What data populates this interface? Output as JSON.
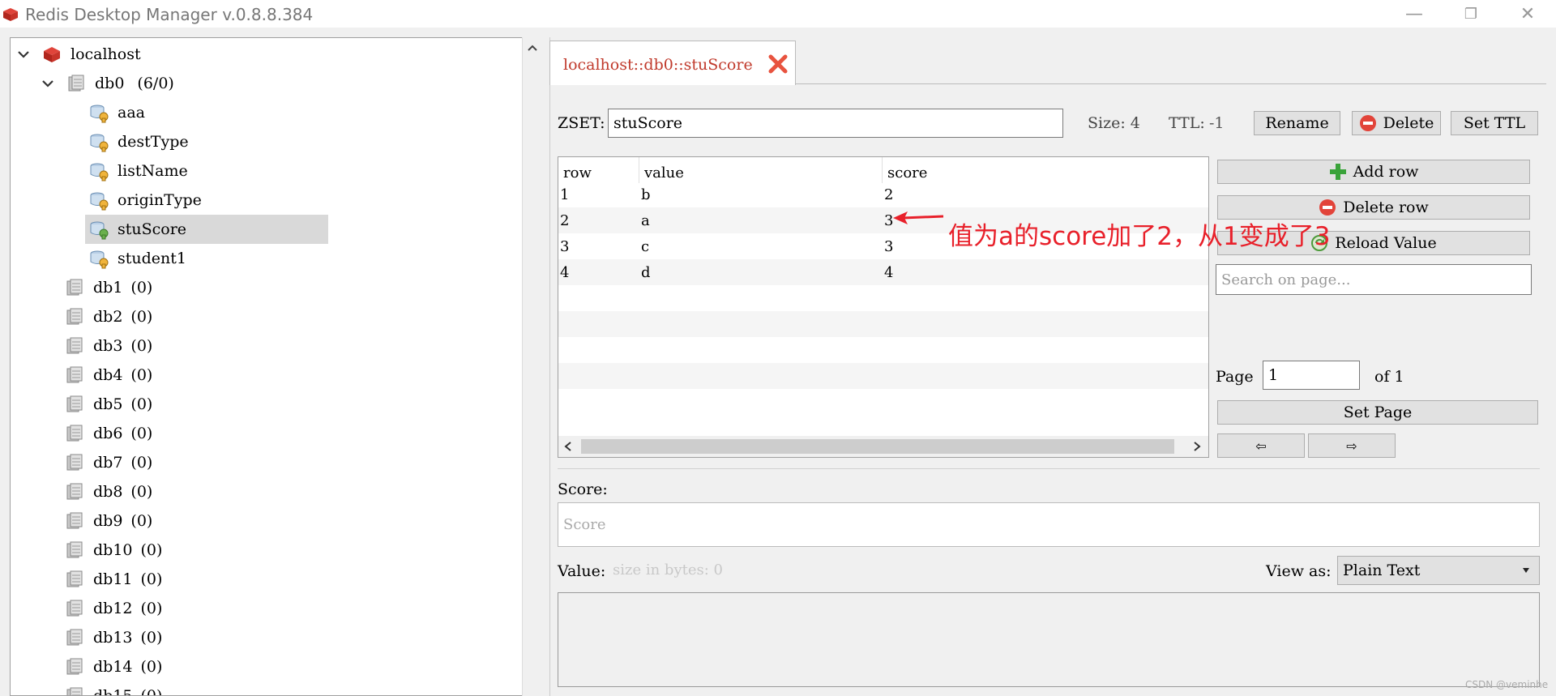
{
  "window": {
    "title": "Redis Desktop Manager v.0.8.8.384",
    "minimize": "—",
    "restore": "❐",
    "close": "✕"
  },
  "tree": {
    "server": "localhost",
    "db0": {
      "name": "db0",
      "count": "(6/0)"
    },
    "keys": [
      "aaa",
      "destType",
      "listName",
      "originType",
      "stuScore",
      "student1"
    ],
    "selected_key": "stuScore",
    "dbs": [
      {
        "name": "db1",
        "count": "(0)"
      },
      {
        "name": "db2",
        "count": "(0)"
      },
      {
        "name": "db3",
        "count": "(0)"
      },
      {
        "name": "db4",
        "count": "(0)"
      },
      {
        "name": "db5",
        "count": "(0)"
      },
      {
        "name": "db6",
        "count": "(0)"
      },
      {
        "name": "db7",
        "count": "(0)"
      },
      {
        "name": "db8",
        "count": "(0)"
      },
      {
        "name": "db9",
        "count": "(0)"
      },
      {
        "name": "db10",
        "count": "(0)"
      },
      {
        "name": "db11",
        "count": "(0)"
      },
      {
        "name": "db12",
        "count": "(0)"
      },
      {
        "name": "db13",
        "count": "(0)"
      },
      {
        "name": "db14",
        "count": "(0)"
      },
      {
        "name": "db15",
        "count": "(0)"
      }
    ]
  },
  "tab": {
    "label": "localhost::db0::stuScore"
  },
  "key_info": {
    "type_label": "ZSET:",
    "key_name": "stuScore",
    "size": "Size: 4",
    "ttl": "TTL:",
    "ttl_value": "-1",
    "rename": "Rename",
    "delete": "Delete",
    "set_ttl": "Set TTL"
  },
  "table": {
    "headers": {
      "row": "row",
      "value": "value",
      "score": "score"
    },
    "rows": [
      {
        "row": "1",
        "value": "b",
        "score": "2"
      },
      {
        "row": "2",
        "value": "a",
        "score": "3"
      },
      {
        "row": "3",
        "value": "c",
        "score": "3"
      },
      {
        "row": "4",
        "value": "d",
        "score": "4"
      }
    ]
  },
  "actions": {
    "add_row": "Add row",
    "delete_row": "Delete row",
    "reload_value": "Reload Value",
    "search_placeholder": "Search on page...",
    "page_label": "Page",
    "page_value": "1",
    "of_label": "of 1",
    "set_page": "Set Page",
    "prev": "⇦",
    "next": "⇨"
  },
  "editor": {
    "score_label": "Score:",
    "score_placeholder": "Score",
    "value_label": "Value:",
    "size_hint": "size in bytes: 0",
    "view_as_label": "View as:",
    "view_as_value": "Plain Text"
  },
  "annotation": "值为a的score加了2，从1变成了3",
  "watermark": "CSDN @veminhe",
  "colors": {
    "annotation": "#e8202a",
    "tab_text": "#c0392b",
    "selection": "#d9d9d9"
  }
}
